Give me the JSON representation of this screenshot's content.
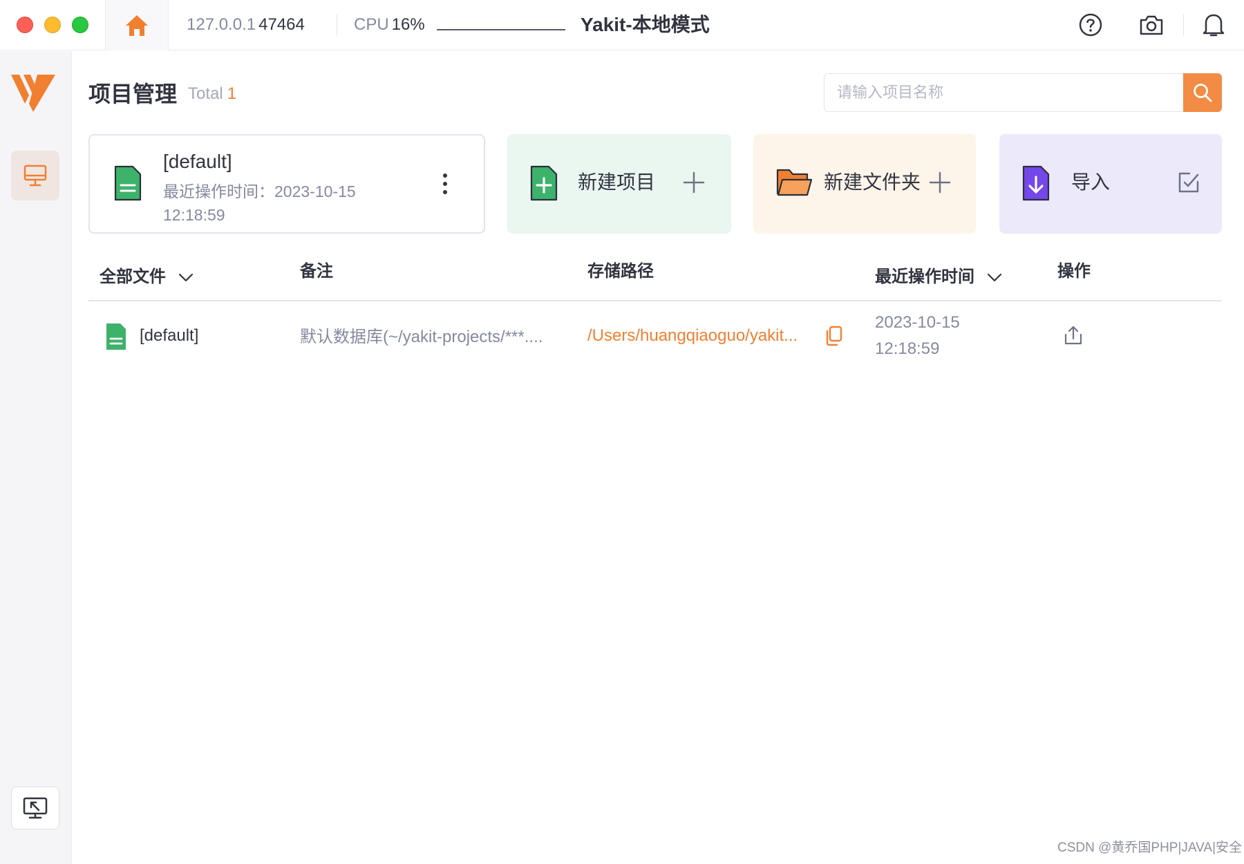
{
  "titlebar": {
    "engine_ip": "127.0.0.1",
    "engine_port": "47464",
    "cpu_label": "CPU",
    "cpu_value": "16%",
    "app_title": "Yakit-本地模式",
    "icons": [
      "home-icon",
      "help-icon",
      "camera-icon",
      "bell-icon"
    ]
  },
  "sidebar": {
    "icons": [
      "yakit-logo-icon",
      "monitor-icon",
      "screen-share-icon"
    ]
  },
  "header": {
    "title": "项目管理",
    "total_label": "Total",
    "total_count": "1",
    "search_placeholder": "请输入项目名称"
  },
  "current_project": {
    "name": "[default]",
    "time_label": "最近操作时间：",
    "time_date": "2023-10-15",
    "time_clock": "12:18:59"
  },
  "actions": {
    "new_project": "新建项目",
    "new_folder": "新建文件夹",
    "import": "导入"
  },
  "table": {
    "columns": [
      "全部文件",
      "备注",
      "存储路径",
      "最近操作时间",
      "操作"
    ],
    "rows": [
      {
        "name": "[default]",
        "remark": "默认数据库(~/yakit-projects/***....",
        "path": "/Users/huangqiaoguo/yakit...",
        "time_date": "2023-10-15",
        "time_clock": "12:18:59"
      }
    ]
  },
  "colors": {
    "accent": "#f17f30",
    "green": "#3db26b",
    "purple": "#7447ea"
  },
  "watermark": "CSDN @黄乔国PHP|JAVA|安全"
}
